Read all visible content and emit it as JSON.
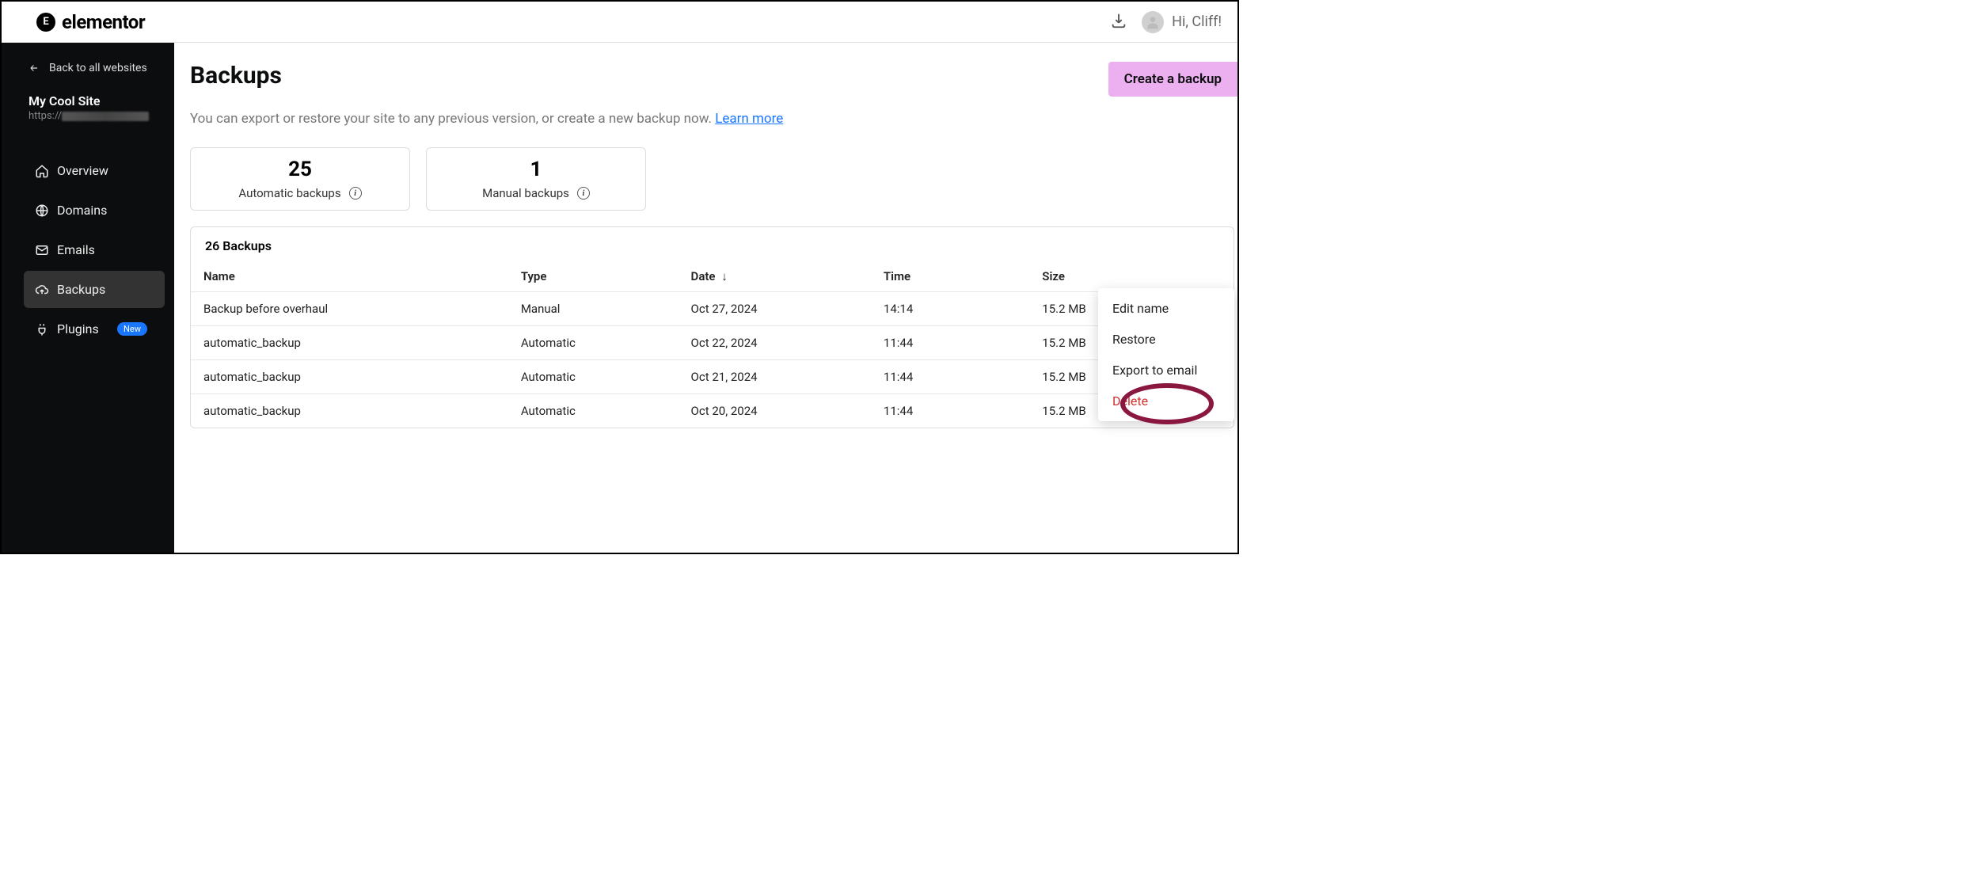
{
  "header": {
    "logo_text": "elementor",
    "greeting": "Hi, Cliff!"
  },
  "sidebar": {
    "back_label": "Back to all websites",
    "site_name": "My Cool Site",
    "site_url_prefix": "https://",
    "nav": [
      {
        "label": "Overview"
      },
      {
        "label": "Domains"
      },
      {
        "label": "Emails"
      },
      {
        "label": "Backups"
      },
      {
        "label": "Plugins",
        "badge": "New"
      }
    ]
  },
  "page": {
    "title": "Backups",
    "create_btn": "Create a backup",
    "desc_pre": "You can export or restore your site to any previous version, or create a new backup now. ",
    "desc_link": "Learn more",
    "stats": [
      {
        "count": "25",
        "label": "Automatic backups"
      },
      {
        "count": "1",
        "label": "Manual backups"
      }
    ],
    "table": {
      "title": "26 Backups",
      "columns": {
        "name": "Name",
        "type": "Type",
        "date": "Date",
        "time": "Time",
        "size": "Size"
      },
      "rows": [
        {
          "name": "Backup before overhaul",
          "type": "Manual",
          "date": "Oct 27, 2024",
          "time": "14:14",
          "size": "15.2 MB"
        },
        {
          "name": "automatic_backup",
          "type": "Automatic",
          "date": "Oct 22, 2024",
          "time": "11:44",
          "size": "15.2 MB"
        },
        {
          "name": "automatic_backup",
          "type": "Automatic",
          "date": "Oct 21, 2024",
          "time": "11:44",
          "size": "15.2 MB"
        },
        {
          "name": "automatic_backup",
          "type": "Automatic",
          "date": "Oct 20, 2024",
          "time": "11:44",
          "size": "15.2 MB"
        }
      ]
    }
  },
  "context_menu": {
    "items": [
      {
        "label": "Edit name"
      },
      {
        "label": "Restore"
      },
      {
        "label": "Export to email"
      },
      {
        "label": "Delete",
        "danger": true
      }
    ]
  }
}
